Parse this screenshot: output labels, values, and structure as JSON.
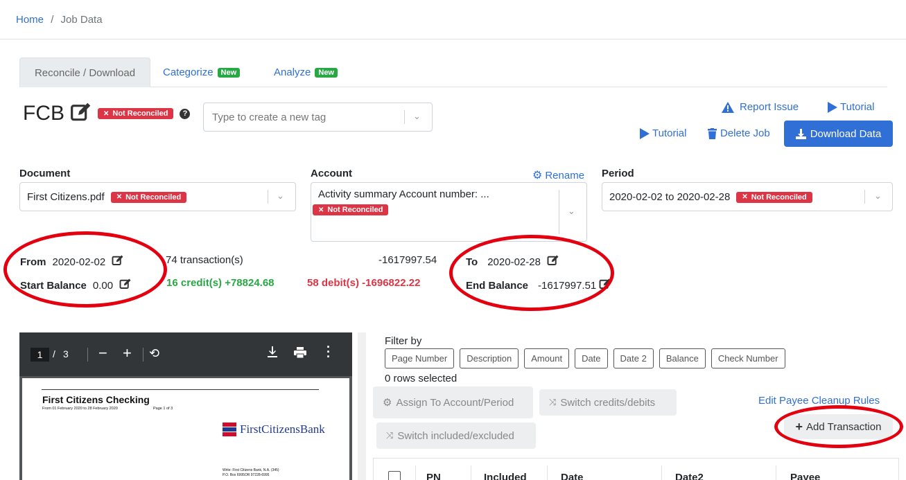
{
  "breadcrumb": {
    "home": "Home",
    "separator": "/",
    "current": "Job Data"
  },
  "tabs": [
    {
      "label": "Reconcile / Download",
      "badge": ""
    },
    {
      "label": "Categorize",
      "badge": "New"
    },
    {
      "label": "Analyze",
      "badge": "New"
    }
  ],
  "job": {
    "title": "FCB",
    "status": "Not Reconciled",
    "help_icon": "question-circle-icon",
    "tag_placeholder": "Type to create a new tag"
  },
  "actions": {
    "report_issue": "Report Issue",
    "tutorial_top": "Tutorial",
    "tutorial": "Tutorial",
    "delete_job": "Delete Job",
    "download_data": "Download Data"
  },
  "document": {
    "label": "Document",
    "value": "First Citizens.pdf",
    "status": "Not Reconciled"
  },
  "account": {
    "label": "Account",
    "rename": "Rename",
    "value": "Activity summary Account number: ...",
    "status": "Not Reconciled"
  },
  "period": {
    "label": "Period",
    "value": "2020-02-02 to 2020-02-28",
    "status": "Not Reconciled"
  },
  "summary": {
    "from_label": "From",
    "from_value": "2020-02-02",
    "start_balance_label": "Start Balance",
    "start_balance_value": "0.00",
    "transactions": "74 transaction(s)",
    "credits": "16 credit(s) +78824.68",
    "net": "-1617997.54",
    "debits": "58 debit(s) -1696822.22",
    "to_label": "To",
    "to_value": "2020-02-28",
    "end_balance_label": "End Balance",
    "end_balance_value": "-1617997.51"
  },
  "pdf_viewer": {
    "page": "1",
    "separator": "/",
    "total_pages": "3",
    "doc_title": "First Citizens Checking",
    "doc_subtitle": "From 01 February 2020 to 28 February 2020",
    "doc_page": "Page 1 of 3",
    "bank_name": "FirstCitizensBank",
    "address_line1": "Write: First Citizens Bank, N.A. (345)",
    "address_line2": "P.O. Box 6995OR 97228-6995"
  },
  "filter": {
    "label": "Filter by",
    "buttons": [
      "Page Number",
      "Description",
      "Amount",
      "Date",
      "Date 2",
      "Balance",
      "Check Number"
    ],
    "rows_selected": "0 rows selected"
  },
  "bulk_actions": {
    "assign": "Assign To Account/Period",
    "switch_credits": "Switch credits/debits",
    "switch_included": "Switch included/excluded",
    "edit_payee": "Edit Payee Cleanup Rules",
    "add_transaction": "Add Transaction"
  },
  "table": {
    "columns": [
      "PN",
      "Included",
      "Date",
      "Date2",
      "Payee"
    ]
  },
  "colors": {
    "primary": "#2f6fd6",
    "danger": "#dc3545",
    "success": "#28a745",
    "annotation": "#e3000f"
  }
}
